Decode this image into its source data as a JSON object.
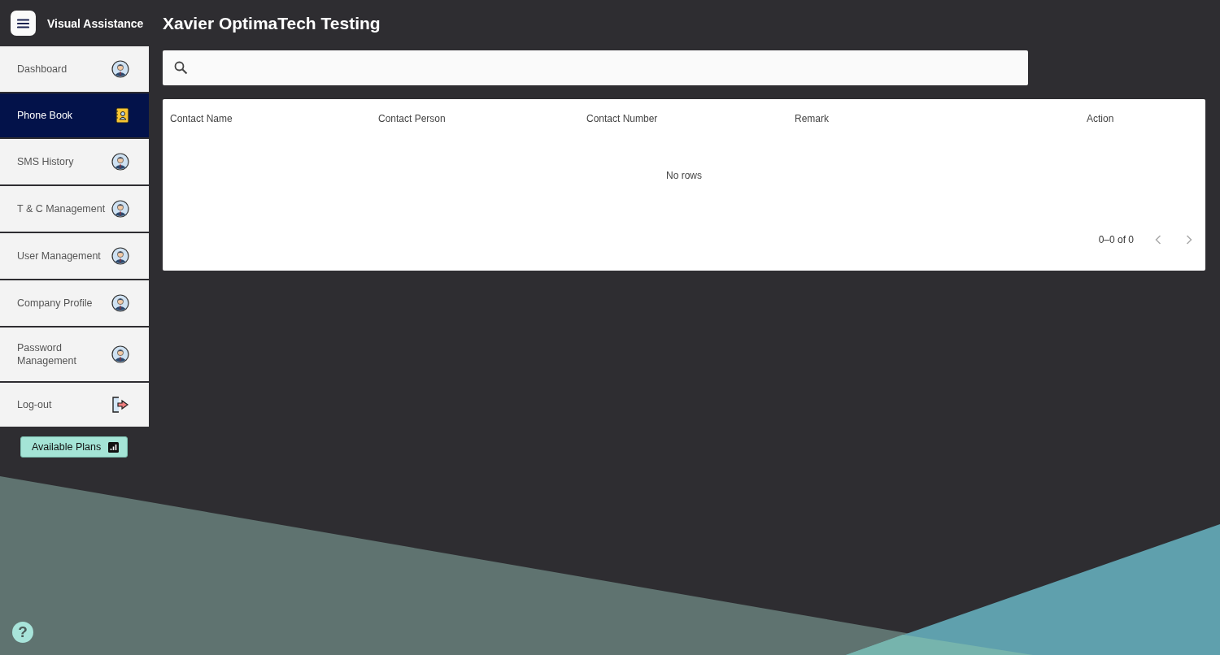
{
  "app": {
    "name": "Visual Assistance"
  },
  "page": {
    "title": "Xavier OptimaTech Testing"
  },
  "sidebar": {
    "items": [
      {
        "label": "Dashboard",
        "kind": "avatar",
        "selected": false
      },
      {
        "label": "Phone Book",
        "kind": "phonebook",
        "selected": true
      },
      {
        "label": "SMS History",
        "kind": "avatar",
        "selected": false
      },
      {
        "label": "T & C Management",
        "kind": "avatar",
        "selected": false
      },
      {
        "label": "User Management",
        "kind": "avatar",
        "selected": false
      },
      {
        "label": "Company Profile",
        "kind": "avatar",
        "selected": false
      },
      {
        "label": "Password Management",
        "kind": "avatar",
        "selected": false
      },
      {
        "label": "Log-out",
        "kind": "logout",
        "selected": false
      }
    ],
    "plans_button": "Available Plans"
  },
  "table": {
    "columns": [
      "Contact Name",
      "Contact Person",
      "Contact Number",
      "Remark",
      "Action"
    ],
    "empty_message": "No rows",
    "pagination": "0–0 of 0"
  },
  "help": "?"
}
